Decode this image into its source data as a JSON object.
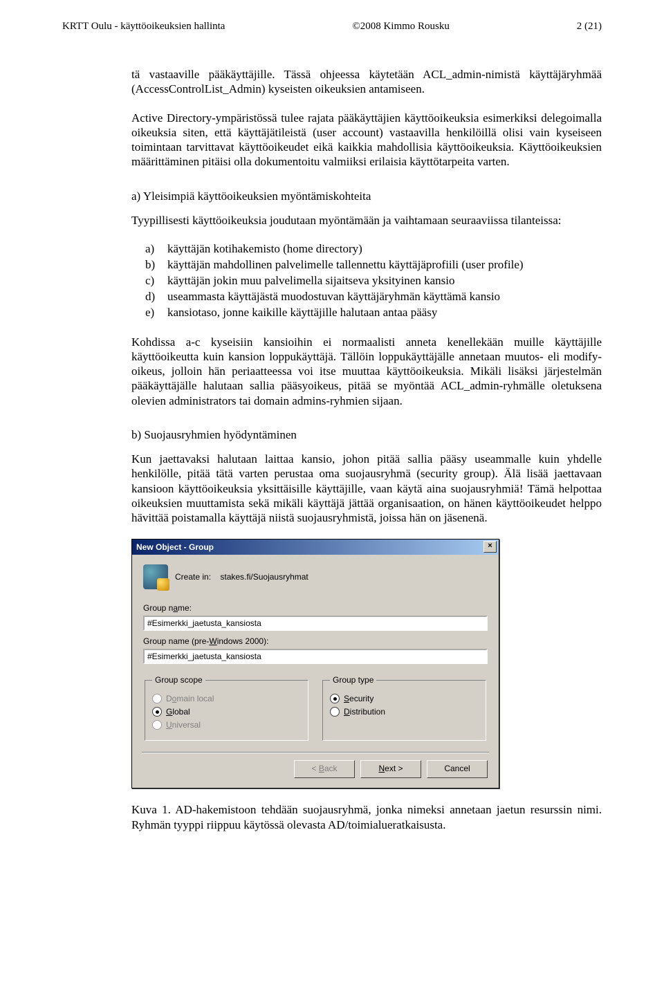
{
  "header": {
    "left": "KRTT Oulu - käyttöoikeuksien hallinta",
    "center": "©2008 Kimmo Rousku",
    "right": "2 (21)"
  },
  "paragraphs": {
    "p1": "tä vastaaville pääkäyttäjille. Tässä ohjeessa käytetään ACL_admin-nimistä käyttäjäryhmää (AccessControlList_Admin) kyseisten oikeuksien antamiseen.",
    "p2": "Active Directory-ympäristössä tulee rajata pääkäyttäjien käyttöoikeuksia esimerkiksi delegoimalla oikeuksia siten, että käyttäjätileistä (user account) vastaavilla henkilöillä olisi vain kyseiseen toimintaan tarvittavat käyttöoikeudet eikä kaikkia mahdollisia käyttöoikeuksia. Käyttöoikeuksien määrittäminen pitäisi olla dokumentoitu valmiiksi erilaisia käyttötarpeita varten.",
    "sec_a_title": "a) Yleisimpiä käyttöoikeuksien myöntämiskohteita",
    "p3": "Tyypillisesti käyttöoikeuksia joudutaan myöntämään ja vaihtamaan seuraaviissa tilanteissa:",
    "p4": "Kohdissa a-c kyseisiin kansioihin ei normaalisti anneta kenellekään muille käyttäjille käyttöoikeutta kuin kansion loppukäyttäjä. Tällöin loppukäyttäjälle annetaan muutos- eli modify-oikeus, jolloin hän periaatteessa voi itse muuttaa käyttöoikeuksia. Mikäli lisäksi järjestelmän pääkäyttäjälle halutaan sallia pääsyoikeus, pitää se myöntää ACL_admin-ryhmälle oletuksena olevien administrators tai domain admins-ryhmien sijaan.",
    "sec_b_title": "b) Suojausryhmien hyödyntäminen",
    "p5": "Kun jaettavaksi halutaan laittaa kansio, johon pitää sallia pääsy useammalle kuin yhdelle henkilölle, pitää tätä varten perustaa oma suojausryhmä (security group). Älä lisää jaettavaan kansioon käyttöoikeuksia yksittäisille käyttäjille, vaan käytä aina suojausryhmiä! Tämä helpottaa oikeuksien muuttamista sekä mikäli käyttäjä jättää organisaation, on hänen käyttöoikeudet helppo hävittää poistamalla käyttäjä niistä suojausryhmistä, joissa hän on jäsenenä."
  },
  "list": [
    {
      "m": "a)",
      "t": "käyttäjän kotihakemisto (home directory)"
    },
    {
      "m": "b)",
      "t": "käyttäjän mahdollinen palvelimelle tallennettu käyttäjäprofiili (user profile)"
    },
    {
      "m": "c)",
      "t": "käyttäjän jokin muu palvelimella sijaitseva yksityinen kansio"
    },
    {
      "m": "d)",
      "t": "useammasta käyttäjästä muodostuvan käyttäjäryhmän käyttämä kansio"
    },
    {
      "m": "e)",
      "t": "kansiotaso, jonne kaikille käyttäjille halutaan antaa pääsy"
    }
  ],
  "dialog": {
    "title": "New Object - Group",
    "close_glyph": "×",
    "create_in_label": "Create in:",
    "create_in_value": "stakes.fi/Suojausryhmat",
    "group_name_label_pre": "Group n",
    "group_name_label_accel": "a",
    "group_name_label_post": "me:",
    "group_name_value": "#Esimerkki_jaetusta_kansiosta",
    "group_pre2000_label_pre": "Group name (pre-",
    "group_pre2000_label_accel": "W",
    "group_pre2000_label_post": "indows 2000):",
    "group_pre2000_value": "#Esimerkki_jaetusta_kansiosta",
    "scope_legend": "Group scope",
    "scope_options": [
      {
        "accel": "o",
        "pre": "D",
        "post": "main local",
        "selected": false,
        "disabled": true
      },
      {
        "accel": "G",
        "pre": "",
        "post": "lobal",
        "selected": true,
        "disabled": false
      },
      {
        "accel": "U",
        "pre": "",
        "post": "niversal",
        "selected": false,
        "disabled": true
      }
    ],
    "type_legend": "Group type",
    "type_options": [
      {
        "accel": "S",
        "pre": "",
        "post": "ecurity",
        "selected": true,
        "disabled": false
      },
      {
        "accel": "D",
        "pre": "",
        "post": "istribution",
        "selected": false,
        "disabled": false
      }
    ],
    "buttons": {
      "back": {
        "pre": "< ",
        "accel": "B",
        "post": "ack",
        "disabled": true
      },
      "next": {
        "pre": "",
        "accel": "N",
        "post": "ext >",
        "disabled": false
      },
      "cancel": {
        "label": "Cancel",
        "disabled": false
      }
    }
  },
  "caption": "Kuva 1. AD-hakemistoon tehdään suojausryhmä, jonka nimeksi annetaan jaetun resurssin nimi. Ryhmän tyyppi riippuu käytössä olevasta AD/toimialueratkaisusta."
}
